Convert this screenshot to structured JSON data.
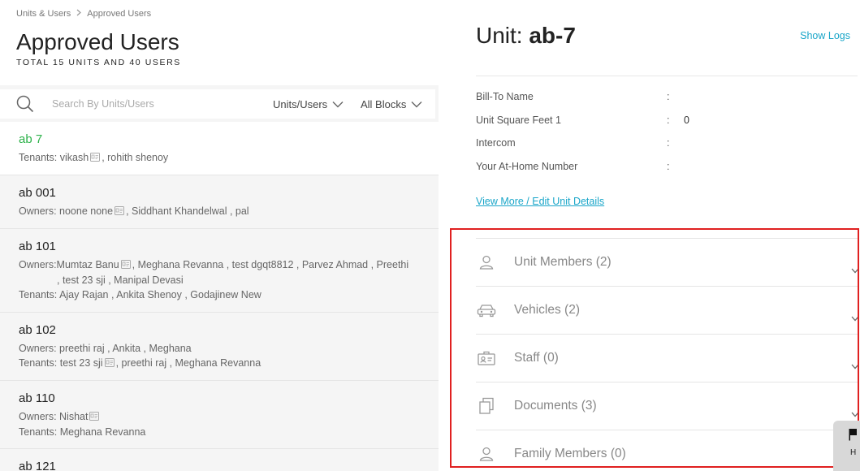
{
  "breadcrumb": {
    "root": "Units & Users",
    "current": "Approved Users"
  },
  "header": {
    "title": "Approved Users",
    "subtitle": "TOTAL 15 UNITS AND 40 USERS"
  },
  "search": {
    "placeholder": "Search By Units/Users",
    "filter_units": "Units/Users",
    "filter_blocks": "All Blocks"
  },
  "units": [
    {
      "name": "ab 7",
      "active": true,
      "lines": [
        {
          "role": "Tenants:",
          "text": "vikash",
          "icon": true,
          "rest": ", rohith shenoy"
        }
      ]
    },
    {
      "name": "ab 001",
      "lines": [
        {
          "role": "Owners:",
          "text": "noone none",
          "icon": true,
          "rest": ", Siddhant Khandelwal , pal"
        }
      ]
    },
    {
      "name": "ab 101",
      "lines": [
        {
          "role": "Owners:",
          "text": "Mumtaz Banu",
          "icon": true,
          "rest": ", Meghana Revanna , test dgqt8812 , Parvez Ahmad , Preethi"
        },
        {
          "role": "",
          "text": ", test 23 sji , Manipal Devasi",
          "icon": false,
          "rest": ""
        },
        {
          "role": "Tenants:",
          "text": "Ajay Rajan , Ankita Shenoy , Godajinew New",
          "icon": false,
          "rest": ""
        }
      ]
    },
    {
      "name": "ab 102",
      "lines": [
        {
          "role": "Owners:",
          "text": "preethi raj , Ankita , Meghana",
          "icon": false,
          "rest": ""
        },
        {
          "role": "Tenants:",
          "text": "test 23 sji",
          "icon": true,
          "rest": ", preethi raj , Meghana Revanna"
        }
      ]
    },
    {
      "name": "ab 110",
      "lines": [
        {
          "role": "Owners:",
          "text": "Nishat",
          "icon": true,
          "rest": ""
        },
        {
          "role": "Tenants:",
          "text": "Meghana Revanna",
          "icon": false,
          "rest": ""
        }
      ]
    },
    {
      "name": "ab 121",
      "lines": []
    }
  ],
  "detail": {
    "title_prefix": "Unit:",
    "title_unit": "ab-7",
    "show_logs": "Show Logs",
    "fields": [
      {
        "label": "Bill-To Name",
        "colon": ":",
        "value": ""
      },
      {
        "label": "Unit Square Feet 1",
        "colon": ":",
        "value": "0"
      },
      {
        "label": "Intercom",
        "colon": ":",
        "value": ""
      },
      {
        "label": "Your At-Home Number",
        "colon": ":",
        "value": ""
      }
    ],
    "view_more": "View More / Edit Unit Details",
    "sections": [
      {
        "label": "Unit Members (2)",
        "icon": "person-icon"
      },
      {
        "label": "Vehicles (2)",
        "icon": "car-icon"
      },
      {
        "label": "Staff (0)",
        "icon": "id-card-icon"
      },
      {
        "label": "Documents (3)",
        "icon": "documents-icon"
      },
      {
        "label": "Family Members (0)",
        "icon": "person-icon"
      }
    ]
  },
  "help": {
    "label": "H"
  },
  "colors": {
    "accent": "#1aa6c9",
    "active_unit": "#2db24a",
    "highlight_box": "#e02020"
  }
}
